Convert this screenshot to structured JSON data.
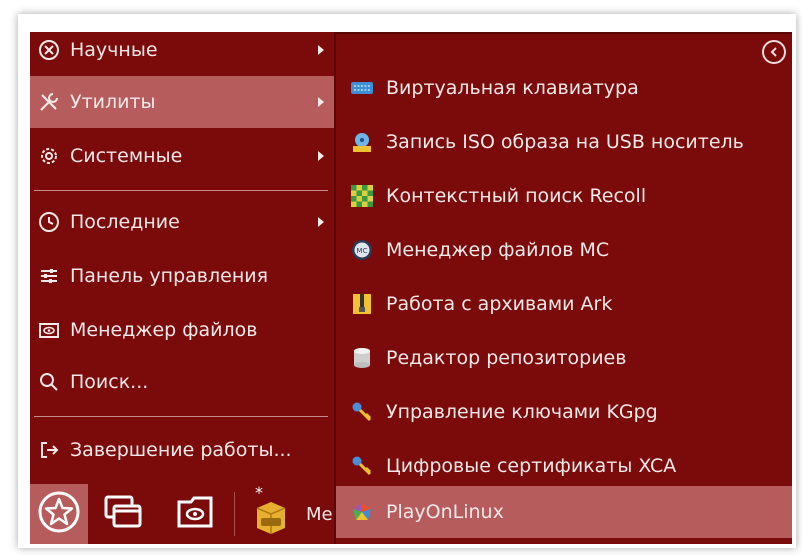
{
  "left_menu": {
    "items": [
      {
        "label": "Научные",
        "icon": "atom-icon",
        "has_submenu": true
      },
      {
        "label": "Утилиты",
        "icon": "tools-icon",
        "has_submenu": true,
        "active": true
      },
      {
        "label": "Системные",
        "icon": "gear-icon",
        "has_submenu": true
      },
      {
        "label": "Последние",
        "icon": "clock-icon",
        "has_submenu": true
      },
      {
        "label": "Панель управления",
        "icon": "sliders-icon",
        "has_submenu": false
      },
      {
        "label": "Менеджер файлов",
        "icon": "file-manager-icon",
        "has_submenu": false
      },
      {
        "label": "Поиск...",
        "icon": "search-icon",
        "has_submenu": false
      },
      {
        "label": "Завершение работы...",
        "icon": "logout-icon",
        "has_submenu": false
      }
    ]
  },
  "submenu": {
    "items": [
      {
        "label": "Виртуальная клавиатура",
        "icon": "keyboard-icon"
      },
      {
        "label": "Запись ISO образа на USB носитель",
        "icon": "usb-writer-icon"
      },
      {
        "label": "Контекстный поиск Recoll",
        "icon": "recoll-icon"
      },
      {
        "label": "Менеджер файлов MC",
        "icon": "mc-icon"
      },
      {
        "label": "Работа с архивами Ark",
        "icon": "archive-icon"
      },
      {
        "label": "Редактор репозиториев",
        "icon": "database-icon"
      },
      {
        "label": "Управление ключами KGpg",
        "icon": "key-icon"
      },
      {
        "label": "Цифровые сертификаты XCA",
        "icon": "certificate-key-icon"
      },
      {
        "label": "PlayOnLinux",
        "icon": "playonlinux-icon",
        "hover": true
      }
    ]
  },
  "taskbar": {
    "start_icon": "start-star-icon",
    "text": "Ме"
  },
  "colors": {
    "menu_bg": "#7b0a0b",
    "highlight": "#b65c5d",
    "text": "#f5e9e9"
  }
}
